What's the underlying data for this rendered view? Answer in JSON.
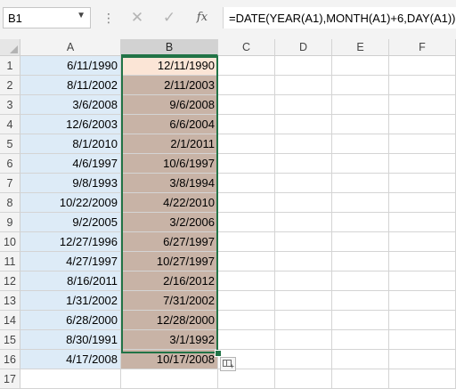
{
  "name_box": {
    "value": "B1"
  },
  "formula_bar": {
    "cancel_symbol": "✕",
    "enter_symbol": "✓",
    "fx_label": "fx",
    "formula": "=DATE(YEAR(A1),MONTH(A1)+6,DAY(A1))"
  },
  "columns": [
    "A",
    "B",
    "C",
    "D",
    "E",
    "F"
  ],
  "selected_column": "B",
  "rows": [
    {
      "num": "1",
      "a": "6/11/1990",
      "b": "12/11/1990"
    },
    {
      "num": "2",
      "a": "8/11/2002",
      "b": "2/11/2003"
    },
    {
      "num": "3",
      "a": "3/6/2008",
      "b": "9/6/2008"
    },
    {
      "num": "4",
      "a": "12/6/2003",
      "b": "6/6/2004"
    },
    {
      "num": "5",
      "a": "8/1/2010",
      "b": "2/1/2011"
    },
    {
      "num": "6",
      "a": "4/6/1997",
      "b": "10/6/1997"
    },
    {
      "num": "7",
      "a": "9/8/1993",
      "b": "3/8/1994"
    },
    {
      "num": "8",
      "a": "10/22/2009",
      "b": "4/22/2010"
    },
    {
      "num": "9",
      "a": "9/2/2005",
      "b": "3/2/2006"
    },
    {
      "num": "10",
      "a": "12/27/1996",
      "b": "6/27/1997"
    },
    {
      "num": "11",
      "a": "4/27/1997",
      "b": "10/27/1997"
    },
    {
      "num": "12",
      "a": "8/16/2011",
      "b": "2/16/2012"
    },
    {
      "num": "13",
      "a": "1/31/2002",
      "b": "7/31/2002"
    },
    {
      "num": "14",
      "a": "6/28/2000",
      "b": "12/28/2000"
    },
    {
      "num": "15",
      "a": "8/30/1991",
      "b": "3/1/1992"
    },
    {
      "num": "16",
      "a": "4/17/2008",
      "b": "10/17/2008"
    },
    {
      "num": "17",
      "a": "",
      "b": ""
    }
  ],
  "colors": {
    "col_a_fill": "#ddebf7",
    "col_b_fill": "#c8b3a6",
    "active_cell_fill": "#fbe5d6",
    "selection_border": "#217346"
  }
}
